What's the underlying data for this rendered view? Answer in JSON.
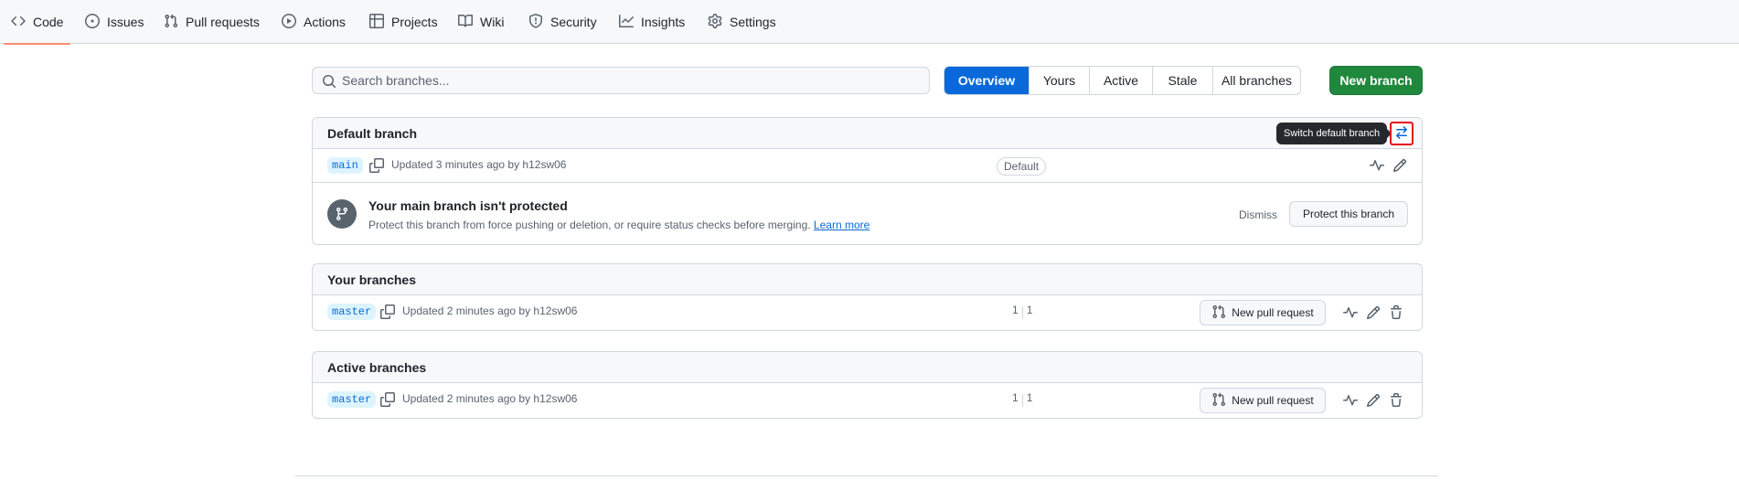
{
  "nav": {
    "tabs": [
      {
        "label": "Code",
        "icon": "code-icon"
      },
      {
        "label": "Issues",
        "icon": "issue-icon"
      },
      {
        "label": "Pull requests",
        "icon": "pull-request-icon"
      },
      {
        "label": "Actions",
        "icon": "play-icon"
      },
      {
        "label": "Projects",
        "icon": "table-icon"
      },
      {
        "label": "Wiki",
        "icon": "book-icon"
      },
      {
        "label": "Security",
        "icon": "shield-icon"
      },
      {
        "label": "Insights",
        "icon": "graph-icon"
      },
      {
        "label": "Settings",
        "icon": "gear-icon"
      }
    ],
    "selected": "Code"
  },
  "search": {
    "placeholder": "Search branches..."
  },
  "filters": {
    "items": [
      "Overview",
      "Yours",
      "Active",
      "Stale",
      "All branches"
    ],
    "active": "Overview"
  },
  "new_branch_label": "New branch",
  "default_section": {
    "title": "Default branch",
    "tooltip": "Switch default branch",
    "branch": {
      "name": "main",
      "updated": "Updated 3 minutes ago by h12sw06",
      "badge": "Default"
    },
    "protect": {
      "title": "Your main branch isn't protected",
      "description": "Protect this branch from force pushing or deletion, or require status checks before merging.",
      "learn_more": "Learn more",
      "dismiss": "Dismiss",
      "button": "Protect this branch"
    }
  },
  "your_section": {
    "title": "Your branches",
    "branch": {
      "name": "master",
      "updated": "Updated 2 minutes ago by h12sw06",
      "behind": "1",
      "ahead": "1",
      "pr_label": "New pull request"
    }
  },
  "active_section": {
    "title": "Active branches",
    "branch": {
      "name": "master",
      "updated": "Updated 2 minutes ago by h12sw06",
      "behind": "1",
      "ahead": "1",
      "pr_label": "New pull request"
    }
  },
  "colors": {
    "accent": "#0969da",
    "primary_button": "#1f883d",
    "selected_tab_underline": "#fd8c73",
    "highlight_box": "#e5101b"
  }
}
